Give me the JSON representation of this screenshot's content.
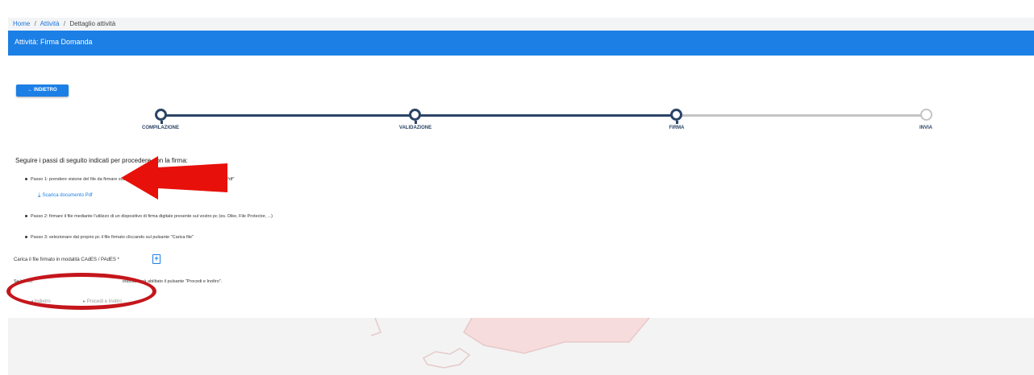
{
  "breadcrumb": {
    "home": "Home",
    "activities": "Attività",
    "detail": "Dettaglio attività",
    "sep": "/"
  },
  "header": {
    "title": "Attività: Firma Domanda"
  },
  "back_button": {
    "label": "INDIETRO",
    "icon": "arrow-left-icon"
  },
  "stepper": {
    "steps": [
      {
        "label": "COMPILAZIONE",
        "status": "done"
      },
      {
        "label": "VALIDAZIONE",
        "status": "done"
      },
      {
        "label": "FIRMA",
        "status": "current"
      },
      {
        "label": "INVIA",
        "status": "todo"
      }
    ],
    "colors": {
      "active": "#2a4466",
      "inactive": "#c4c4c4"
    }
  },
  "instructions": {
    "intro": "Seguire i passi di seguito indicati per procedere con la firma:",
    "step1": "Passo 1: prendere visione del file da firmare scaricandolo mediante il pulsante \"Scarica documento Pdf\"",
    "download_label": "Scarica documento Pdf",
    "step2": "Passo 2: firmare il file mediante l'utilizzo di un dispositivo di firma digitale presente sul vostro pc (es. Dike, File Protector, ...)",
    "step3": "Passo 3: selezionare dal proprio pc il file firmato cliccando sul pulsante \"Carica file\""
  },
  "upload": {
    "label": "Carica il file firmato in modalità CAdES / PAdES *",
    "icon": "file-upload-icon"
  },
  "note": {
    "start": "Se hai eff",
    "end": "indicati sarà abilitato il pulsante \"Procedi e Inoltro\"."
  },
  "nav": {
    "back_label": "Indietro",
    "proceed_label": "Procedi e Inoltro"
  },
  "colors": {
    "primary": "#1b7fe6",
    "annotation_red": "#c4161c"
  }
}
